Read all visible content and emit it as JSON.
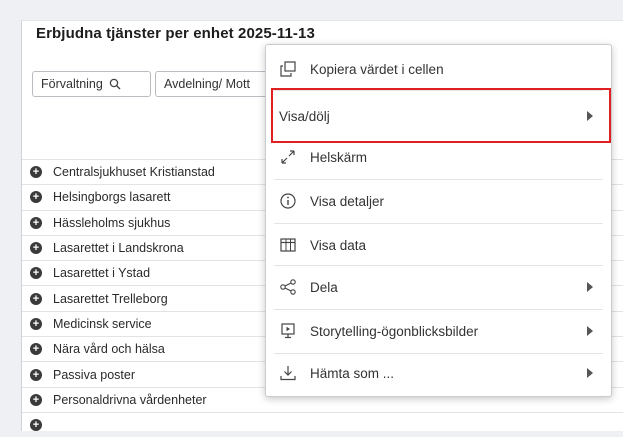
{
  "panel": {
    "title": "Erbjudna tjänster per enhet 2025-11-13",
    "filters": [
      {
        "label": "Förvaltning"
      },
      {
        "label": "Avdelning/ Mott"
      }
    ]
  },
  "rows": [
    "Centralsjukhuset Kristianstad",
    "Helsingborgs lasarett",
    "Hässleholms sjukhus",
    "Lasarettet i Landskrona",
    "Lasarettet i Ystad",
    "Lasarettet Trelleborg",
    "Medicinsk service",
    "Nära vård och hälsa",
    "Passiva poster",
    "Personaldrivna vårdenheter"
  ],
  "context_menu": {
    "items": [
      {
        "label": "Kopiera värdet i cellen",
        "icon": "copy-icon",
        "submenu": false
      },
      {
        "label": "Visa/dölj",
        "icon": "",
        "submenu": true
      },
      {
        "label": "Helskärm",
        "icon": "expand-icon",
        "submenu": false
      },
      {
        "label": "Visa detaljer",
        "icon": "info-icon",
        "submenu": false
      },
      {
        "label": "Visa data",
        "icon": "table-icon",
        "submenu": false
      },
      {
        "label": "Dela",
        "icon": "share-icon",
        "submenu": true
      },
      {
        "label": "Storytelling-ögonblicksbilder",
        "icon": "snapshot-icon",
        "submenu": true
      },
      {
        "label": "Hämta som ...",
        "icon": "download-icon",
        "submenu": true
      }
    ]
  },
  "highlight_color": "#e02020"
}
